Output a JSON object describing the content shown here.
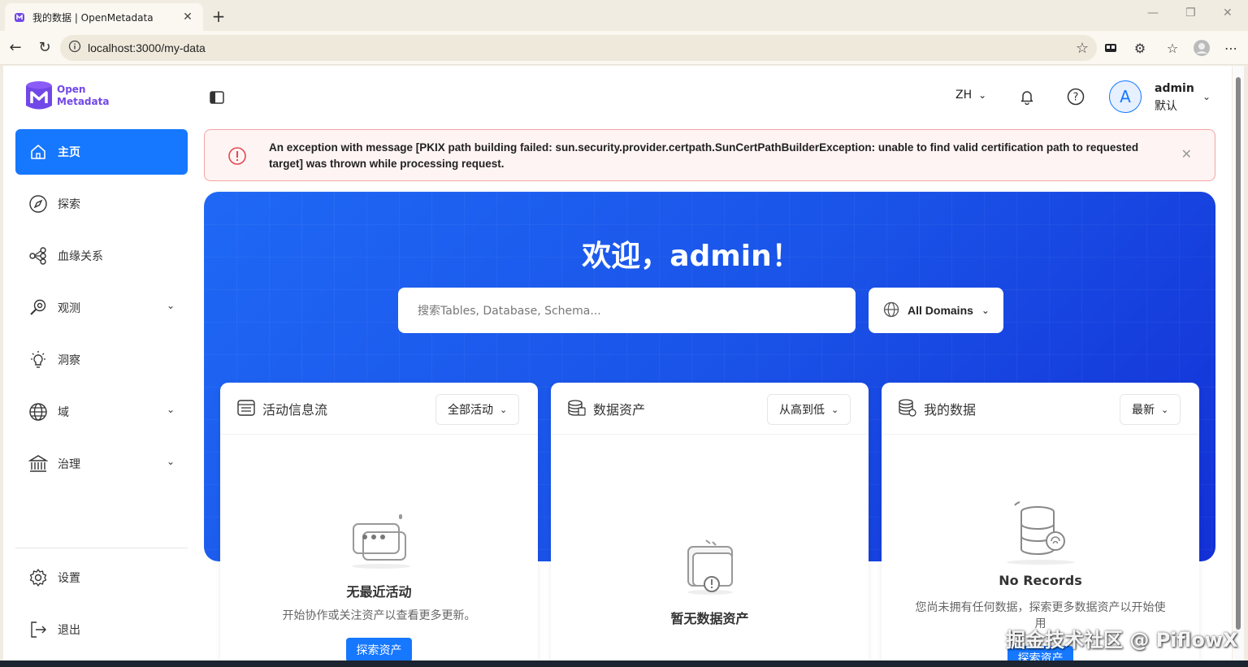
{
  "browser": {
    "tab_title": "我的数据 | OpenMetadata",
    "url": "localhost:3000/my-data"
  },
  "logo": {
    "line1": "Open",
    "line2": "Metadata"
  },
  "sidebar": {
    "items": [
      {
        "label": "主页",
        "icon": "home-icon"
      },
      {
        "label": "探索",
        "icon": "compass-icon"
      },
      {
        "label": "血缘关系",
        "icon": "lineage-icon"
      },
      {
        "label": "观测",
        "icon": "observability-icon"
      },
      {
        "label": "洞察",
        "icon": "insights-icon"
      },
      {
        "label": "域",
        "icon": "globe-icon"
      },
      {
        "label": "治理",
        "icon": "governance-icon"
      }
    ],
    "settings": "设置",
    "logout": "退出"
  },
  "header": {
    "lang": "ZH",
    "avatar_letter": "A",
    "user_name": "admin",
    "user_role": "默认"
  },
  "alert": {
    "message": "An exception with message [PKIX path building failed: sun.security.provider.certpath.SunCertPathBuilderException: unable to find valid certification path to requested target] was thrown while processing request."
  },
  "hero": {
    "welcome": "欢迎，admin！",
    "search_placeholder": "搜索Tables, Database, Schema...",
    "domains": "All Domains"
  },
  "cards": [
    {
      "title": "活动信息流",
      "select": "全部活动",
      "empty_title": "无最近活动",
      "empty_sub": "开始协作或关注资产以查看更多更新。",
      "button": "探索资产"
    },
    {
      "title": "数据资产",
      "select": "从高到低",
      "empty_title": "暂无数据资产"
    },
    {
      "title": "我的数据",
      "select": "最新",
      "empty_title": "No Records",
      "empty_sub": "您尚未拥有任何数据，探索更多数据资产以开始使用",
      "button": "探索资产"
    }
  ],
  "watermark": "掘金技术社区 @ PiflowX",
  "colors": {
    "primary": "#1677ff",
    "brand": "#7147e8",
    "alert_border": "#f4a5a5"
  }
}
